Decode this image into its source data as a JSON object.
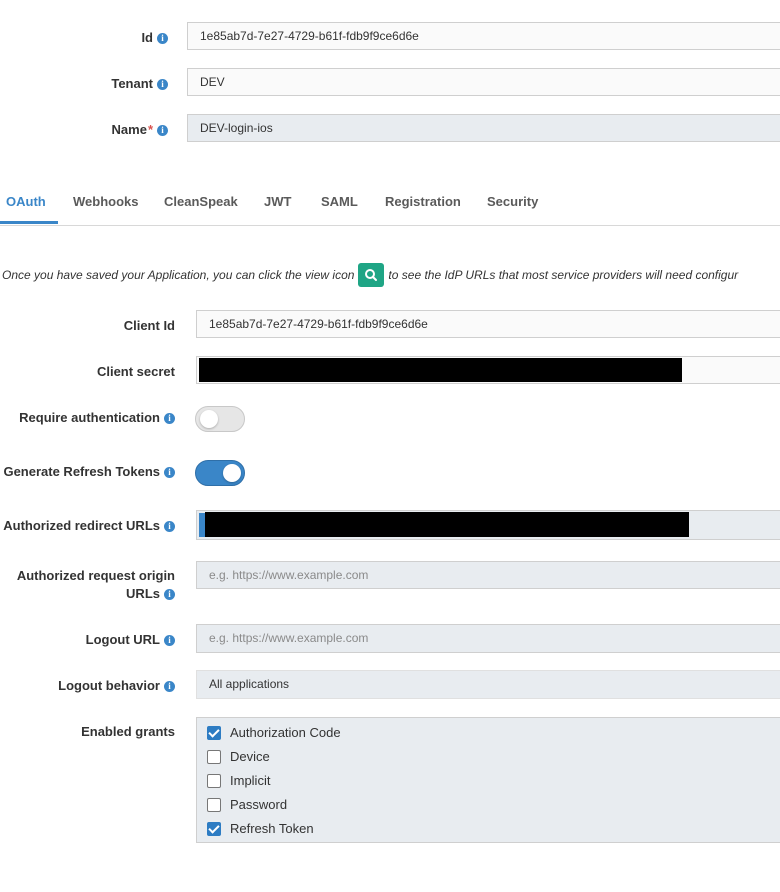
{
  "form": {
    "id_label": "Id",
    "id_value": "1e85ab7d-7e27-4729-b61f-fdb9f9ce6d6e",
    "tenant_label": "Tenant",
    "tenant_value": "DEV",
    "name_label": "Name",
    "name_required": "*",
    "name_value": "DEV-login-ios"
  },
  "tabs": [
    "OAuth",
    "Webhooks",
    "CleanSpeak",
    "JWT",
    "SAML",
    "Registration",
    "Security"
  ],
  "active_tab": "OAuth",
  "oauth": {
    "note_before": "Once you have saved your Application, you can click the view icon",
    "note_after": "to see the IdP URLs that most service providers will need configur",
    "client_id_label": "Client Id",
    "client_id_value": "1e85ab7d-7e27-4729-b61f-fdb9f9ce6d6e",
    "client_secret_label": "Client secret",
    "require_auth_label": "Require authentication",
    "require_auth_on": false,
    "refresh_tokens_label": "Generate Refresh Tokens",
    "refresh_tokens_on": true,
    "redirect_urls_label": "Authorized redirect URLs",
    "origin_urls_label_1": "Authorized request origin",
    "origin_urls_label_2": "URLs",
    "origin_urls_placeholder": "e.g. https://www.example.com",
    "logout_url_label": "Logout URL",
    "logout_url_placeholder": "e.g. https://www.example.com",
    "logout_behavior_label": "Logout behavior",
    "logout_behavior_value": "All applications",
    "enabled_grants_label": "Enabled grants",
    "grants": [
      {
        "label": "Authorization Code",
        "checked": true
      },
      {
        "label": "Device",
        "checked": false
      },
      {
        "label": "Implicit",
        "checked": false
      },
      {
        "label": "Password",
        "checked": false
      },
      {
        "label": "Refresh Token",
        "checked": true
      }
    ]
  },
  "colors": {
    "accent": "#3a86c8",
    "view_button": "#1fa585",
    "redaction": "#000000"
  },
  "icons": {
    "info": "info-icon",
    "view": "magnifier-icon"
  }
}
